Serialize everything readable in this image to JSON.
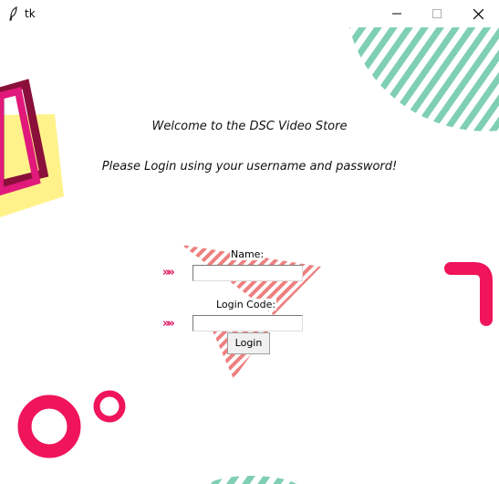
{
  "window": {
    "title": "tk"
  },
  "colors": {
    "pink": "#f0145a",
    "mint": "#7fcfb3",
    "yellow": "#fff28a",
    "salmon": "#ee7f7f",
    "magenta": "#e0197a",
    "maroon": "#8a0f3a"
  },
  "welcome": {
    "line1": "Welcome to the DSC Video Store",
    "line2": "Please Login using your username and password!"
  },
  "form": {
    "name_label": "Name:",
    "name_value": "",
    "code_label": "Login Code:",
    "code_value": "",
    "arrow_marker": "»»",
    "login_button": "Login"
  }
}
